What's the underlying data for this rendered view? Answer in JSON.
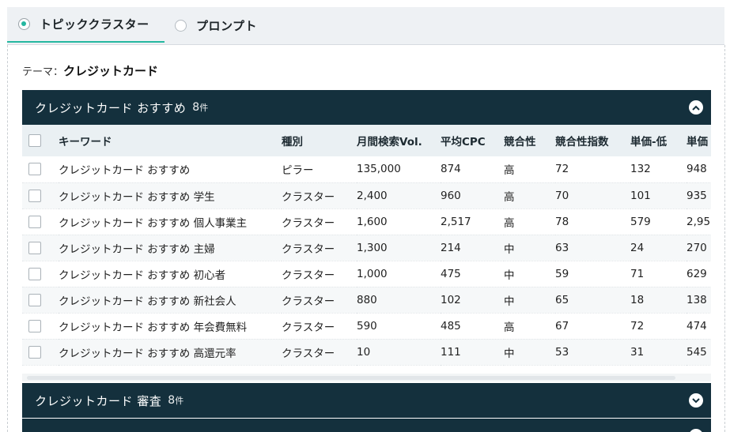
{
  "tabs": [
    {
      "label": "トピッククラスター",
      "selected": true
    },
    {
      "label": "プロンプト",
      "selected": false
    }
  ],
  "theme": {
    "label": "テーマ：",
    "value": "クレジットカード"
  },
  "clusters": [
    {
      "title": "クレジットカード おすすめ",
      "count": "8",
      "count_unit": "件",
      "expanded": true
    },
    {
      "title": "クレジットカード 審査",
      "count": "8",
      "count_unit": "件",
      "expanded": false
    }
  ],
  "table": {
    "headers": [
      "キーワード",
      "種別",
      "月間検索Vol.",
      "平均CPC",
      "競合性",
      "競合性指数",
      "単価-低",
      "単価"
    ],
    "rows": [
      [
        "クレジットカード おすすめ",
        "ピラー",
        "135,000",
        "874",
        "高",
        "72",
        "132",
        "948"
      ],
      [
        "クレジットカード おすすめ 学生",
        "クラスター",
        "2,400",
        "960",
        "高",
        "70",
        "101",
        "935"
      ],
      [
        "クレジットカード おすすめ 個人事業主",
        "クラスター",
        "1,600",
        "2,517",
        "高",
        "78",
        "579",
        "2,95"
      ],
      [
        "クレジットカード おすすめ 主婦",
        "クラスター",
        "1,300",
        "214",
        "中",
        "63",
        "24",
        "270"
      ],
      [
        "クレジットカード おすすめ 初心者",
        "クラスター",
        "1,000",
        "475",
        "中",
        "59",
        "71",
        "629"
      ],
      [
        "クレジットカード おすすめ 新社会人",
        "クラスター",
        "880",
        "102",
        "中",
        "65",
        "18",
        "138"
      ],
      [
        "クレジットカード おすすめ 年会費無料",
        "クラスター",
        "590",
        "485",
        "高",
        "67",
        "72",
        "474"
      ],
      [
        "クレジットカード おすすめ 高還元率",
        "クラスター",
        "10",
        "111",
        "中",
        "53",
        "31",
        "545"
      ]
    ]
  },
  "colors": {
    "accent": "#25b7a0",
    "header_bg": "#14303d",
    "table_header_bg": "#eaf0f3"
  }
}
